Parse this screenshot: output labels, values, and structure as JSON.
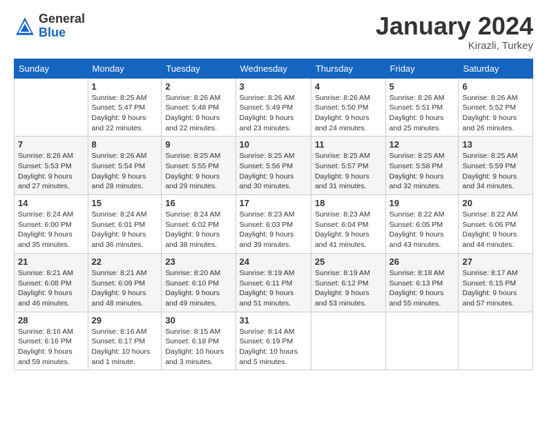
{
  "logo": {
    "general": "General",
    "blue": "Blue"
  },
  "title": "January 2024",
  "location": "Kirazli, Turkey",
  "days_of_week": [
    "Sunday",
    "Monday",
    "Tuesday",
    "Wednesday",
    "Thursday",
    "Friday",
    "Saturday"
  ],
  "weeks": [
    [
      {
        "day": "",
        "info": ""
      },
      {
        "day": "1",
        "info": "Sunrise: 8:25 AM\nSunset: 5:47 PM\nDaylight: 9 hours\nand 22 minutes."
      },
      {
        "day": "2",
        "info": "Sunrise: 8:26 AM\nSunset: 5:48 PM\nDaylight: 9 hours\nand 22 minutes."
      },
      {
        "day": "3",
        "info": "Sunrise: 8:26 AM\nSunset: 5:49 PM\nDaylight: 9 hours\nand 23 minutes."
      },
      {
        "day": "4",
        "info": "Sunrise: 8:26 AM\nSunset: 5:50 PM\nDaylight: 9 hours\nand 24 minutes."
      },
      {
        "day": "5",
        "info": "Sunrise: 8:26 AM\nSunset: 5:51 PM\nDaylight: 9 hours\nand 25 minutes."
      },
      {
        "day": "6",
        "info": "Sunrise: 8:26 AM\nSunset: 5:52 PM\nDaylight: 9 hours\nand 26 minutes."
      }
    ],
    [
      {
        "day": "7",
        "info": "Sunrise: 8:26 AM\nSunset: 5:53 PM\nDaylight: 9 hours\nand 27 minutes."
      },
      {
        "day": "8",
        "info": "Sunrise: 8:26 AM\nSunset: 5:54 PM\nDaylight: 9 hours\nand 28 minutes."
      },
      {
        "day": "9",
        "info": "Sunrise: 8:25 AM\nSunset: 5:55 PM\nDaylight: 9 hours\nand 29 minutes."
      },
      {
        "day": "10",
        "info": "Sunrise: 8:25 AM\nSunset: 5:56 PM\nDaylight: 9 hours\nand 30 minutes."
      },
      {
        "day": "11",
        "info": "Sunrise: 8:25 AM\nSunset: 5:57 PM\nDaylight: 9 hours\nand 31 minutes."
      },
      {
        "day": "12",
        "info": "Sunrise: 8:25 AM\nSunset: 5:58 PM\nDaylight: 9 hours\nand 32 minutes."
      },
      {
        "day": "13",
        "info": "Sunrise: 8:25 AM\nSunset: 5:59 PM\nDaylight: 9 hours\nand 34 minutes."
      }
    ],
    [
      {
        "day": "14",
        "info": "Sunrise: 8:24 AM\nSunset: 6:00 PM\nDaylight: 9 hours\nand 35 minutes."
      },
      {
        "day": "15",
        "info": "Sunrise: 8:24 AM\nSunset: 6:01 PM\nDaylight: 9 hours\nand 36 minutes."
      },
      {
        "day": "16",
        "info": "Sunrise: 8:24 AM\nSunset: 6:02 PM\nDaylight: 9 hours\nand 38 minutes."
      },
      {
        "day": "17",
        "info": "Sunrise: 8:23 AM\nSunset: 6:03 PM\nDaylight: 9 hours\nand 39 minutes."
      },
      {
        "day": "18",
        "info": "Sunrise: 8:23 AM\nSunset: 6:04 PM\nDaylight: 9 hours\nand 41 minutes."
      },
      {
        "day": "19",
        "info": "Sunrise: 8:22 AM\nSunset: 6:05 PM\nDaylight: 9 hours\nand 43 minutes."
      },
      {
        "day": "20",
        "info": "Sunrise: 8:22 AM\nSunset: 6:06 PM\nDaylight: 9 hours\nand 44 minutes."
      }
    ],
    [
      {
        "day": "21",
        "info": "Sunrise: 8:21 AM\nSunset: 6:08 PM\nDaylight: 9 hours\nand 46 minutes."
      },
      {
        "day": "22",
        "info": "Sunrise: 8:21 AM\nSunset: 6:09 PM\nDaylight: 9 hours\nand 48 minutes."
      },
      {
        "day": "23",
        "info": "Sunrise: 8:20 AM\nSunset: 6:10 PM\nDaylight: 9 hours\nand 49 minutes."
      },
      {
        "day": "24",
        "info": "Sunrise: 8:19 AM\nSunset: 6:11 PM\nDaylight: 9 hours\nand 51 minutes."
      },
      {
        "day": "25",
        "info": "Sunrise: 8:19 AM\nSunset: 6:12 PM\nDaylight: 9 hours\nand 53 minutes."
      },
      {
        "day": "26",
        "info": "Sunrise: 8:18 AM\nSunset: 6:13 PM\nDaylight: 9 hours\nand 55 minutes."
      },
      {
        "day": "27",
        "info": "Sunrise: 8:17 AM\nSunset: 6:15 PM\nDaylight: 9 hours\nand 57 minutes."
      }
    ],
    [
      {
        "day": "28",
        "info": "Sunrise: 8:16 AM\nSunset: 6:16 PM\nDaylight: 9 hours\nand 59 minutes."
      },
      {
        "day": "29",
        "info": "Sunrise: 8:16 AM\nSunset: 6:17 PM\nDaylight: 10 hours\nand 1 minute."
      },
      {
        "day": "30",
        "info": "Sunrise: 8:15 AM\nSunset: 6:18 PM\nDaylight: 10 hours\nand 3 minutes."
      },
      {
        "day": "31",
        "info": "Sunrise: 8:14 AM\nSunset: 6:19 PM\nDaylight: 10 hours\nand 5 minutes."
      },
      {
        "day": "",
        "info": ""
      },
      {
        "day": "",
        "info": ""
      },
      {
        "day": "",
        "info": ""
      }
    ]
  ]
}
